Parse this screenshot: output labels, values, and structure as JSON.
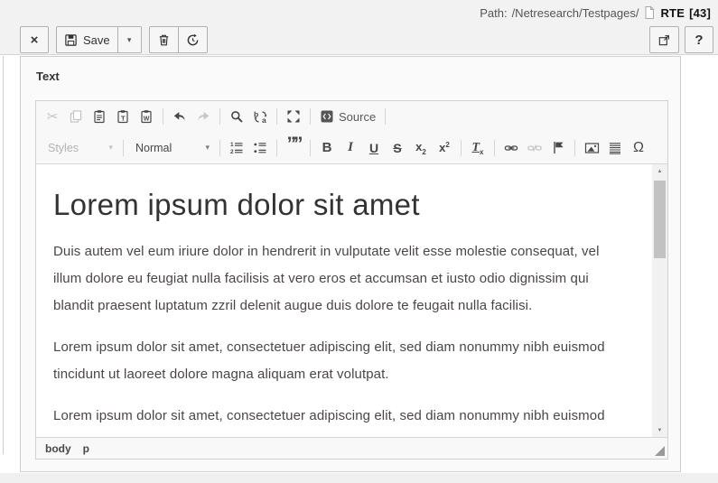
{
  "colors": {
    "docheader_bg": "#f2f2f2",
    "panel_bg": "#fafafa",
    "editor_chrome_bg": "#f8f8f8",
    "icon": "#474747",
    "icon_disabled": "#c3c3c3",
    "body_text": "#4a4648",
    "border": "#cfcfcf"
  },
  "header": {
    "path_label": "Path:",
    "path_value": "/Netresearch/Testpages/",
    "record_title": "RTE",
    "record_uid": "[43]"
  },
  "docheader": {
    "close": "×",
    "save": "Save",
    "save_caret": "▾",
    "help": "?"
  },
  "panel": {
    "label": "Text"
  },
  "rte": {
    "toolbar": {
      "styles": "Styles",
      "format": "Normal",
      "source": "Source",
      "glyphs": {
        "cut": "✂",
        "quote": "””",
        "bold": "B",
        "italic": "I",
        "underline": "U",
        "strike": "S",
        "sub_base": "x",
        "sub_mark": "2",
        "sup_base": "x",
        "sup_mark": "2",
        "removeformat_t": "T",
        "removeformat_x": "x",
        "omega": "Ω",
        "combo_caret": "▾",
        "scroll_up": "▲",
        "scroll_down": "▼"
      }
    },
    "content": {
      "heading": "Lorem ipsum dolor sit amet",
      "paragraphs": [
        "Duis autem vel eum iriure dolor in hendrerit in vulputate velit esse molestie consequat, vel illum dolore eu feugiat nulla facilisis at vero eros et accumsan et iusto odio dignissim qui blandit praesent luptatum zzril delenit augue duis dolore te feugait nulla facilisi.",
        "Lorem ipsum dolor sit amet, consectetuer adipiscing elit, sed diam nonummy nibh euismod tincidunt ut laoreet dolore magna aliquam erat volutpat.",
        "Lorem ipsum dolor sit amet, consectetuer adipiscing elit, sed diam nonummy nibh euismod tincidunt ut laoreet dolore magna aliquam erat volutpat."
      ]
    },
    "status_path": [
      "body",
      "p"
    ]
  }
}
